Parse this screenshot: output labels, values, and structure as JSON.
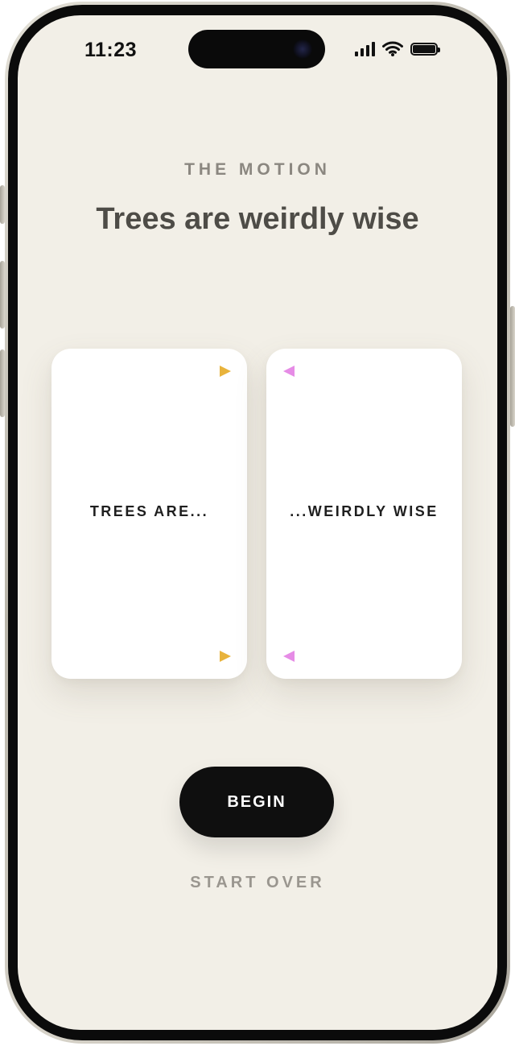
{
  "status_bar": {
    "time": "11:23",
    "icons": [
      "signal-icon",
      "wifi-icon",
      "battery-icon"
    ]
  },
  "motion": {
    "eyebrow": "THE MOTION",
    "title": "Trees are weirdly wise"
  },
  "cards": [
    {
      "text": "TREES ARE...",
      "marker_icon": "triangle-right-icon",
      "marker_color": "#e8b33c"
    },
    {
      "text": "...WEIRDLY WISE",
      "marker_icon": "triangle-left-icon",
      "marker_color": "#e68ce6"
    }
  ],
  "actions": {
    "begin_label": "BEGIN",
    "start_over_label": "START OVER"
  },
  "colors": {
    "background": "#f2efe7",
    "primary_button": "#0f0f0f",
    "title_text": "#4e4c47"
  }
}
